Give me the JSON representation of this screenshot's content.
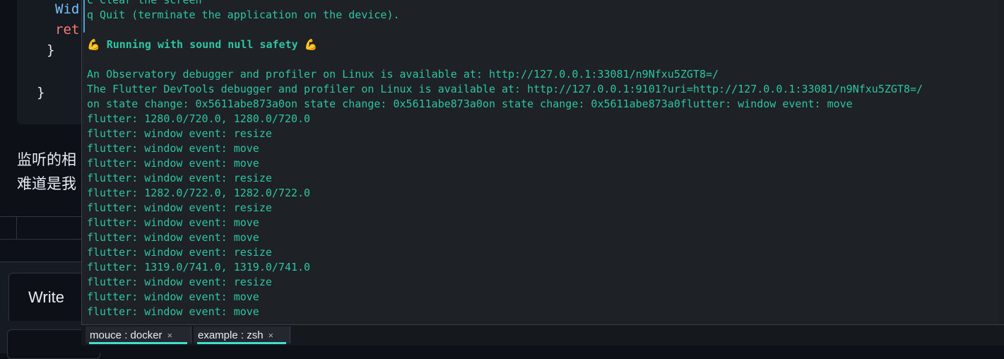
{
  "background_page": {
    "code_lines": [
      {
        "text": "Wid",
        "color": "#79c0ff"
      },
      {
        "text": "ret",
        "color": "#ff7b72"
      },
      {
        "text": "}",
        "color": "#e6edf3"
      },
      {
        "text": "}",
        "color": "#e6edf3"
      }
    ],
    "comment_text_line1": "监听的相",
    "comment_text_line2": "难道是我",
    "write_tab_label": "Write"
  },
  "terminal": {
    "lines": [
      {
        "text": "c Clear the screen",
        "bold": false
      },
      {
        "text": "q Quit (terminate the application on the device).",
        "bold": false
      },
      {
        "text": "",
        "bold": false
      },
      {
        "text": "💪 Running with sound null safety 💪",
        "bold": true
      },
      {
        "text": "",
        "bold": false
      },
      {
        "text": "An Observatory debugger and profiler on Linux is available at: http://127.0.0.1:33081/n9Nfxu5ZGT8=/",
        "bold": false
      },
      {
        "text": "The Flutter DevTools debugger and profiler on Linux is available at: http://127.0.0.1:9101?uri=http://127.0.0.1:33081/n9Nfxu5ZGT8=/",
        "bold": false
      },
      {
        "text": "on state change: 0x5611abe873a0on state change: 0x5611abe873a0on state change: 0x5611abe873a0flutter: window event: move",
        "bold": false
      },
      {
        "text": "flutter: 1280.0/720.0, 1280.0/720.0",
        "bold": false
      },
      {
        "text": "flutter: window event: resize",
        "bold": false
      },
      {
        "text": "flutter: window event: move",
        "bold": false
      },
      {
        "text": "flutter: window event: move",
        "bold": false
      },
      {
        "text": "flutter: window event: resize",
        "bold": false
      },
      {
        "text": "flutter: 1282.0/722.0, 1282.0/722.0",
        "bold": false
      },
      {
        "text": "flutter: window event: resize",
        "bold": false
      },
      {
        "text": "flutter: window event: move",
        "bold": false
      },
      {
        "text": "flutter: window event: move",
        "bold": false
      },
      {
        "text": "flutter: window event: resize",
        "bold": false
      },
      {
        "text": "flutter: 1319.0/741.0, 1319.0/741.0",
        "bold": false
      },
      {
        "text": "flutter: window event: resize",
        "bold": false
      },
      {
        "text": "flutter: window event: move",
        "bold": false
      },
      {
        "text": "flutter: window event: move",
        "bold": false
      }
    ],
    "text_color": "#2ec4a2",
    "tabs": [
      {
        "label": "mouce : docker",
        "close": "×"
      },
      {
        "label": "example : zsh",
        "close": "×"
      }
    ],
    "accent": "#40e0d0"
  }
}
